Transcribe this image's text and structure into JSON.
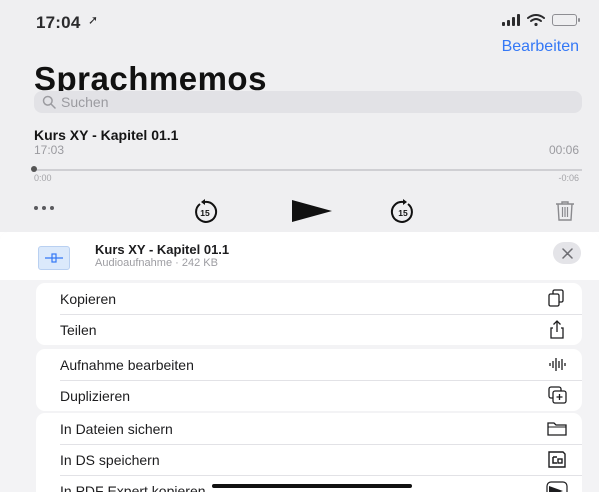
{
  "status_bar": {
    "time": "17:04",
    "location_glyph": "➚"
  },
  "header": {
    "edit_label": "Bearbeiten",
    "title": "Sprachmemos"
  },
  "search": {
    "placeholder": "Suchen"
  },
  "recording": {
    "title": "Kurs XY - Kapitel 01.1",
    "recorded_time": "17:03",
    "duration": "00:06",
    "position_start": "0:00",
    "position_end": "-0:06",
    "playback_progress": 0
  },
  "controls": {
    "skip_back_seconds": "15",
    "skip_forward_seconds": "15"
  },
  "share_sheet": {
    "file_title": "Kurs XY - Kapitel 01.1",
    "file_subtitle": "Audioaufnahme · 242 KB",
    "groups": [
      {
        "items": [
          {
            "label": "Kopieren",
            "icon": "copy-icon"
          },
          {
            "label": "Teilen",
            "icon": "share-icon"
          }
        ]
      },
      {
        "items": [
          {
            "label": "Aufnahme bearbeiten",
            "icon": "waveform-icon"
          },
          {
            "label": "Duplizieren",
            "icon": "duplicate-icon"
          }
        ]
      },
      {
        "items": [
          {
            "label": "In Dateien sichern",
            "icon": "folder-icon"
          },
          {
            "label": "In DS speichern",
            "icon": "ds-file-icon"
          },
          {
            "label": "In PDF Expert kopieren",
            "icon": "pdf-expert-icon"
          }
        ]
      }
    ]
  },
  "colors": {
    "accent": "#3478f6",
    "background": "#efeff1",
    "sheet": "#f3f3f5"
  }
}
